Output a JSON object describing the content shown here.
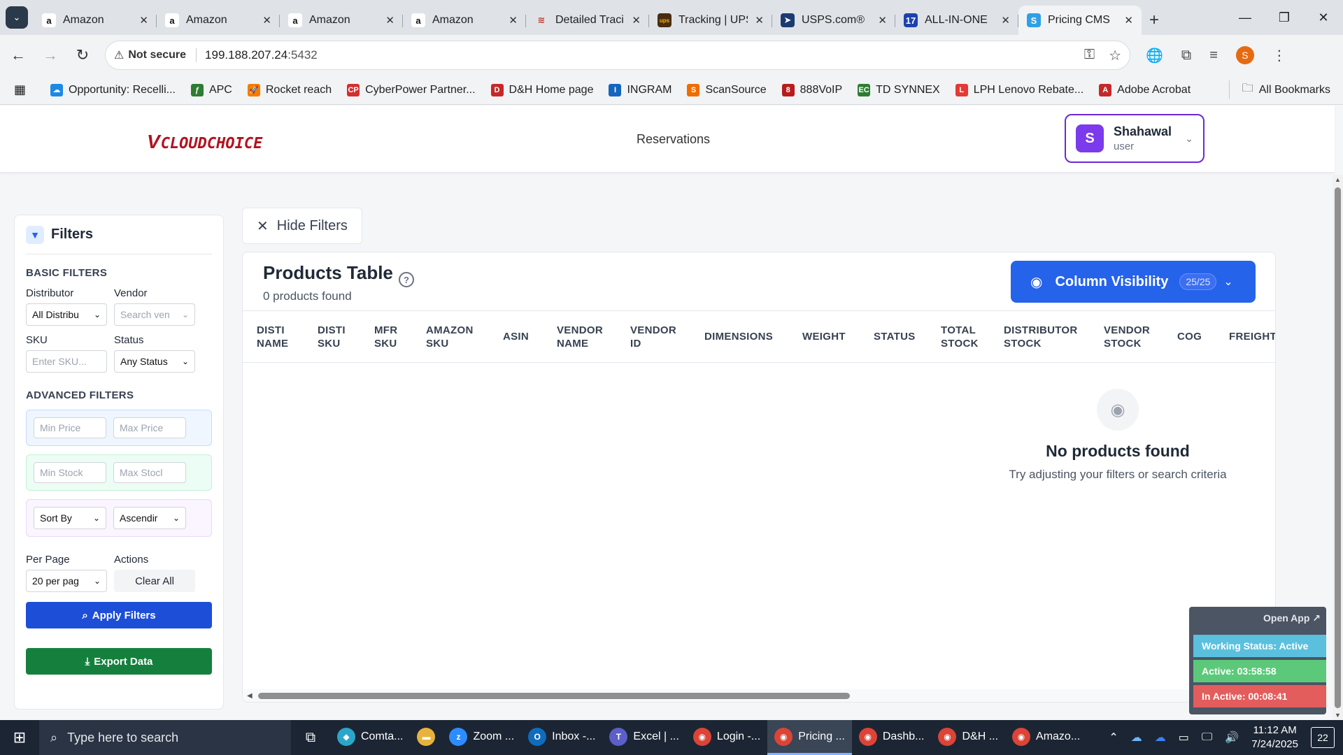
{
  "browser": {
    "tabs": [
      {
        "title": "Amazon",
        "icon": "amazon-icon",
        "favicon_text": "a",
        "favicon_bg": "#ffffff",
        "favicon_fg": "#111111"
      },
      {
        "title": "Amazon",
        "icon": "amazon-icon",
        "favicon_text": "a",
        "favicon_bg": "#ffffff",
        "favicon_fg": "#111111"
      },
      {
        "title": "Amazon",
        "icon": "amazon-icon",
        "favicon_text": "a",
        "favicon_bg": "#ffffff",
        "favicon_fg": "#111111"
      },
      {
        "title": "Amazon",
        "icon": "amazon-icon",
        "favicon_text": "a",
        "favicon_bg": "#ffffff",
        "favicon_fg": "#111111"
      },
      {
        "title": "Detailed Traci",
        "icon": "tracking-icon",
        "favicon_text": "≋",
        "favicon_bg": "#dfe3e8",
        "favicon_fg": "#c0392b"
      },
      {
        "title": "Tracking | UPS",
        "icon": "ups-icon",
        "favicon_text": "ups",
        "favicon_bg": "#4a2c12",
        "favicon_fg": "#f5b400"
      },
      {
        "title": "USPS.com®",
        "icon": "usps-icon",
        "favicon_text": "➤",
        "favicon_bg": "#1b3a72",
        "favicon_fg": "#ffffff"
      },
      {
        "title": "ALL-IN-ONE",
        "icon": "allinone-icon",
        "favicon_text": "17",
        "favicon_bg": "#1e40af",
        "favicon_fg": "#ffffff"
      },
      {
        "title": "Pricing CMS",
        "icon": "pricing-cms-icon",
        "favicon_text": "S",
        "favicon_bg": "#2ea0e6",
        "favicon_fg": "#ffffff",
        "active": true
      }
    ],
    "window_controls": {
      "minimize": "—",
      "restore": "❐",
      "close": "✕"
    },
    "address": {
      "security_label": "Not secure",
      "url_host": "199.188.207.24",
      "url_port": ":5432"
    },
    "profile_initial": "S",
    "bookmarks": [
      {
        "label": "Opportunity: Recelli...",
        "icon": "cloud-icon",
        "color": "#1e88e5",
        "glyph": "☁"
      },
      {
        "label": "APC",
        "icon": "apc-icon",
        "color": "#2e7d32",
        "glyph": "ƒ"
      },
      {
        "label": "Rocket reach",
        "icon": "rocket-icon",
        "color": "#f57c00",
        "glyph": "🚀"
      },
      {
        "label": "CyberPower Partner...",
        "icon": "cyberpower-icon",
        "color": "#d32f2f",
        "glyph": "CP"
      },
      {
        "label": "D&H Home page",
        "icon": "dh-icon",
        "color": "#c62828",
        "glyph": "D"
      },
      {
        "label": "INGRAM",
        "icon": "ingram-icon",
        "color": "#1565c0",
        "glyph": "I"
      },
      {
        "label": "ScanSource",
        "icon": "scansource-icon",
        "color": "#ef6c00",
        "glyph": "S"
      },
      {
        "label": "888VoIP",
        "icon": "voip-icon",
        "color": "#b71c1c",
        "glyph": "8"
      },
      {
        "label": "TD SYNNEX",
        "icon": "tdsynnex-icon",
        "color": "#2e7d32",
        "glyph": "EC"
      },
      {
        "label": "LPH Lenovo Rebate...",
        "icon": "lenovo-icon",
        "color": "#e53935",
        "glyph": "L"
      },
      {
        "label": "Adobe Acrobat",
        "icon": "adobe-icon",
        "color": "#c62828",
        "glyph": "A"
      }
    ],
    "all_bookmarks": "All Bookmarks"
  },
  "header": {
    "logo_v": "V",
    "logo_text": "CLOUDCHOICE",
    "nav_reservations": "Reservations",
    "user": {
      "initial": "S",
      "name": "Shahawal",
      "role": "user"
    }
  },
  "filters": {
    "title": "Filters",
    "basic_title": "BASIC FILTERS",
    "distributor_label": "Distributor",
    "distributor_value": "All Distribu",
    "vendor_label": "Vendor",
    "vendor_placeholder": "Search ven",
    "sku_label": "SKU",
    "sku_placeholder": "Enter SKU...",
    "status_label": "Status",
    "status_value": "Any Status",
    "advanced_title": "ADVANCED FILTERS",
    "min_price": "Min Price",
    "max_price": "Max Price",
    "min_stock": "Min Stock",
    "max_stock": "Max Stocl",
    "sort_by": "Sort By",
    "sort_order": "Ascendir",
    "per_page_label": "Per Page",
    "per_page_value": "20 per pag",
    "actions_label": "Actions",
    "clear_all": "Clear All",
    "apply": "Apply Filters",
    "export": "Export Data"
  },
  "main": {
    "hide_filters": "Hide Filters",
    "table_title": "Products Table",
    "products_count": "0 products found",
    "column_visibility": "Column Visibility",
    "column_visibility_badge": "25/25",
    "columns": [
      {
        "label": "DISTI\nNAME"
      },
      {
        "label": "DISTI\nSKU"
      },
      {
        "label": "MFR\nSKU"
      },
      {
        "label": "AMAZON\nSKU"
      },
      {
        "label": "ASIN"
      },
      {
        "label": "VENDOR\nNAME"
      },
      {
        "label": "VENDOR\nID"
      },
      {
        "label": "DIMENSIONS"
      },
      {
        "label": "WEIGHT"
      },
      {
        "label": "STATUS"
      },
      {
        "label": "TOTAL\nSTOCK"
      },
      {
        "label": "DISTRIBUTOR\nSTOCK"
      },
      {
        "label": "VENDOR\nSTOCK"
      },
      {
        "label": "COG"
      },
      {
        "label": "FREIGHT"
      }
    ],
    "empty_title": "No products found",
    "empty_subtitle": "Try adjusting your filters or search criteria"
  },
  "status_widget": {
    "open_app": "Open App ↗",
    "working_status": "Working Status: Active",
    "active": "Active: 03:58:58",
    "inactive": "In Active: 00:08:41"
  },
  "taskbar": {
    "search_placeholder": "Type here to search",
    "apps": [
      {
        "label": "Comta...",
        "icon": "comtab-icon",
        "color": "#2aa6c9",
        "glyph": "◆"
      },
      {
        "label": "",
        "icon": "file-explorer-icon",
        "color": "#e8b33c",
        "glyph": "▬"
      },
      {
        "label": "Zoom ...",
        "icon": "zoom-icon",
        "color": "#2d8cff",
        "glyph": "z"
      },
      {
        "label": "Inbox -...",
        "icon": "outlook-icon",
        "color": "#0f6cbd",
        "glyph": "O"
      },
      {
        "label": "Excel | ...",
        "icon": "teams-icon",
        "color": "#5b5fc7",
        "glyph": "T"
      },
      {
        "label": "Login -...",
        "icon": "chrome-icon",
        "color": "#db4437",
        "glyph": "◉"
      },
      {
        "label": "Pricing ...",
        "icon": "chrome-icon",
        "color": "#db4437",
        "glyph": "◉",
        "active": true
      },
      {
        "label": "Dashb...",
        "icon": "chrome-icon",
        "color": "#db4437",
        "glyph": "◉"
      },
      {
        "label": "D&H ...",
        "icon": "chrome-icon",
        "color": "#db4437",
        "glyph": "◉"
      },
      {
        "label": "Amazo...",
        "icon": "chrome-icon",
        "color": "#db4437",
        "glyph": "◉"
      }
    ],
    "time": "11:12 AM",
    "date": "7/24/2025",
    "notifications": "22"
  }
}
